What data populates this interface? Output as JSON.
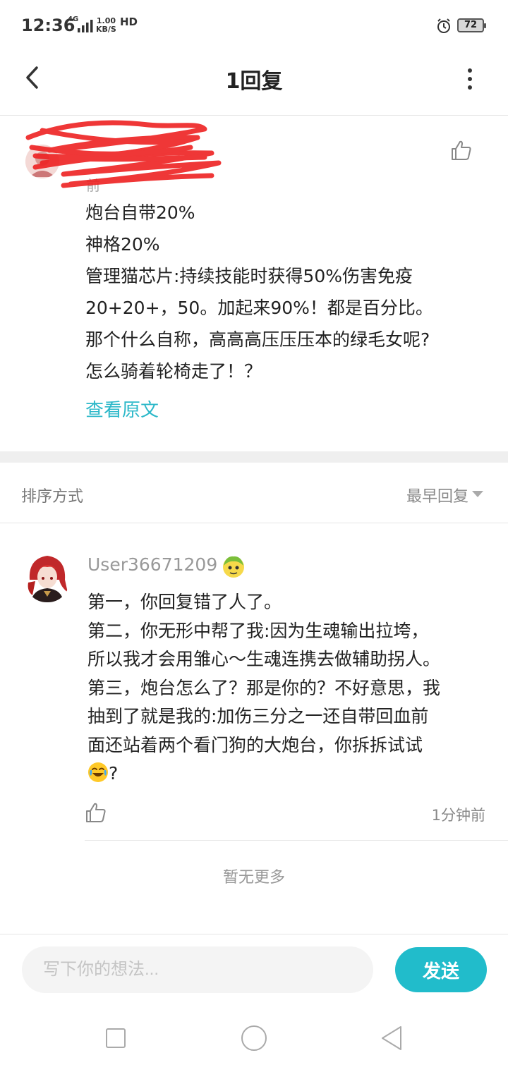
{
  "status_bar": {
    "time": "12:36",
    "network": "4G",
    "speed_value": "1.00",
    "speed_unit": "KB/S",
    "hd": "HD",
    "battery": "72"
  },
  "header": {
    "title": "1回复",
    "back_icon": "chevron-left-icon",
    "more_icon": "more-vertical-icon"
  },
  "original_post": {
    "author_name": "",
    "time_partial": "前",
    "content_lines": [
      "炮台自带20%",
      "神格20%",
      "管理猫芯片:持续技能时获得50%伤害免疫",
      "20+20+，50。加起来90%！都是百分比。",
      "那个什么自称，高高高压压压本的绿毛女呢?",
      "怎么骑着轮椅走了！？"
    ],
    "view_original": "查看原文"
  },
  "sort": {
    "label": "排序方式",
    "value": "最早回复"
  },
  "reply": {
    "username": "User36671209",
    "content_lines": [
      "第一，你回复错了人了。",
      "第二，你无形中帮了我:因为生魂输出拉垮，",
      "所以我才会用雏心～生魂连携去做辅助拐人。",
      "第三，炮台怎么了？那是你的？不好意思，我",
      "抽到了就是我的:加伤三分之一还自带回血前",
      "面还站着两个看门狗的大炮台，你拆拆试试",
      "?"
    ],
    "time": "1分钟前"
  },
  "no_more": "暂无更多",
  "input": {
    "placeholder": "写下你的想法...",
    "send_label": "发送"
  },
  "colors": {
    "accent": "#21bccb",
    "link": "#2cb8c9",
    "scribble": "#ee2222"
  }
}
